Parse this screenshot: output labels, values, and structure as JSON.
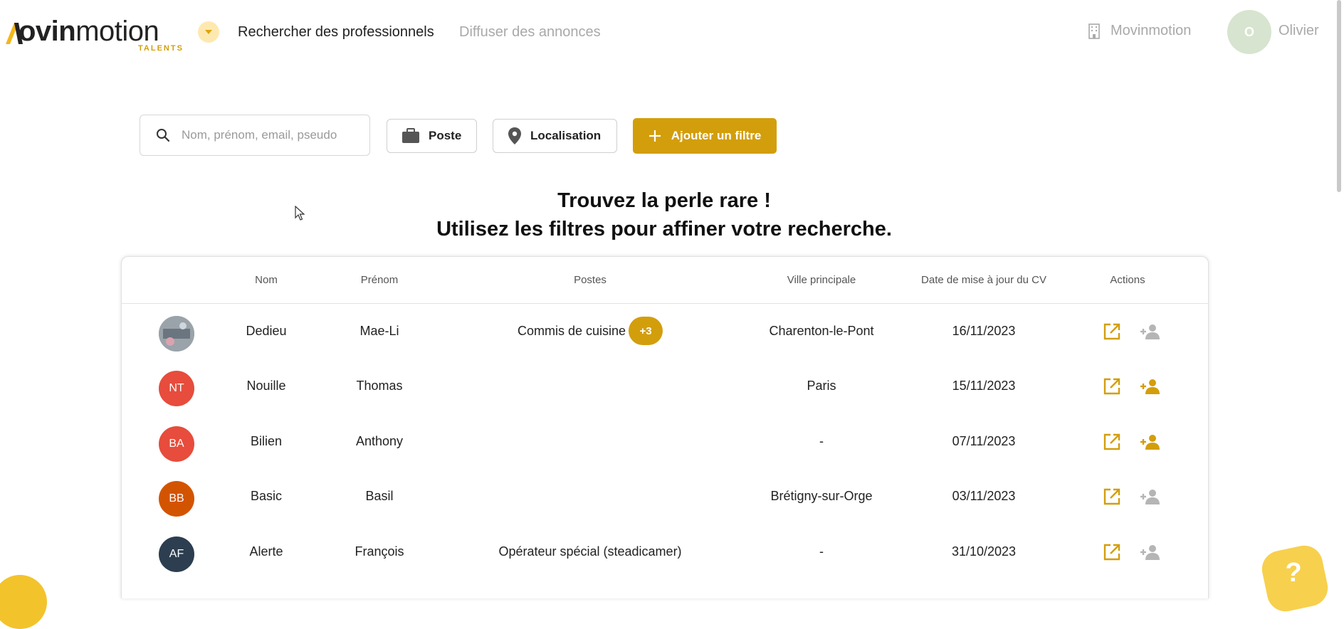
{
  "header": {
    "logo_bold": "ovin",
    "logo_light": "motion",
    "logo_sub": "TALENTS",
    "nav_active": "Rechercher des professionnels",
    "nav_inactive": "Diffuser des annonces",
    "org_name": "Movinmotion",
    "user_initial": "O",
    "user_name": "Olivier"
  },
  "filters": {
    "search_placeholder": "Nom, prénom, email, pseudo",
    "poste_label": "Poste",
    "localisation_label": "Localisation",
    "add_filter_label": "Ajouter un filtre"
  },
  "hero": {
    "line1": "Trouvez la perle rare !",
    "line2": "Utilisez les filtres pour affiner votre recherche."
  },
  "table": {
    "headers": {
      "nom": "Nom",
      "prenom": "Prénom",
      "postes": "Postes",
      "ville": "Ville principale",
      "date": "Date de mise à jour du CV",
      "actions": "Actions"
    },
    "rows": [
      {
        "initials": "",
        "avatar_color": "#9aa3aa",
        "nom": "Dedieu",
        "prenom": "Mae-Li",
        "poste": "Commis de cuisine",
        "extra": "+3",
        "ville": "Charenton-le-Pont",
        "date": "16/11/2023",
        "add_active": false
      },
      {
        "initials": "NT",
        "avatar_color": "#e74c3c",
        "nom": "Nouille",
        "prenom": "Thomas",
        "poste": "",
        "extra": "",
        "ville": "Paris",
        "date": "15/11/2023",
        "add_active": true
      },
      {
        "initials": "BA",
        "avatar_color": "#e74c3c",
        "nom": "Bilien",
        "prenom": "Anthony",
        "poste": "",
        "extra": "",
        "ville": "-",
        "date": "07/11/2023",
        "add_active": true
      },
      {
        "initials": "BB",
        "avatar_color": "#d35400",
        "nom": "Basic",
        "prenom": "Basil",
        "poste": "",
        "extra": "",
        "ville": "Brétigny-sur-Orge",
        "date": "03/11/2023",
        "add_active": false
      },
      {
        "initials": "AF",
        "avatar_color": "#2c3e50",
        "nom": "Alerte",
        "prenom": "François",
        "poste": "Opérateur spécial (steadicamer)",
        "extra": "",
        "ville": "-",
        "date": "31/10/2023",
        "add_active": false
      }
    ]
  },
  "colors": {
    "accent": "#d39e0b",
    "action_inactive": "#b5b5b5"
  },
  "help_label": "?"
}
